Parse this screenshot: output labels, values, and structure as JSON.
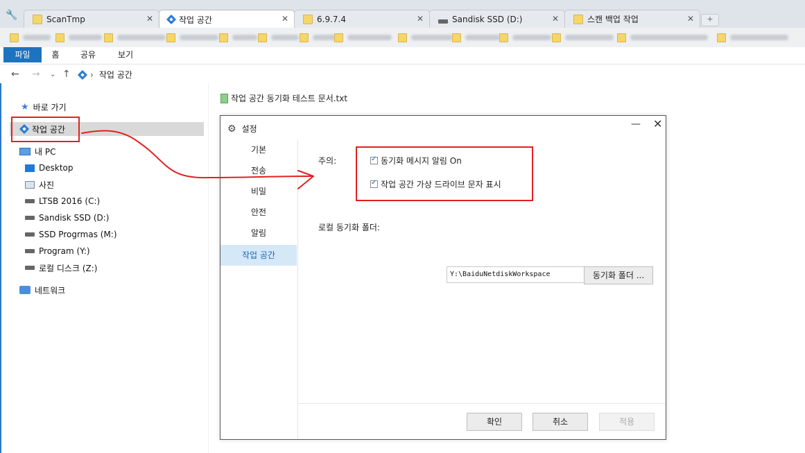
{
  "browser_tabs": [
    {
      "label": "ScanTmp",
      "icon": "folder-icon"
    },
    {
      "label": "작업 공간",
      "icon": "workspace-icon",
      "active": true
    },
    {
      "label": "6.9.7.4",
      "icon": "folder-icon"
    },
    {
      "label": "Sandisk SSD (D:)",
      "icon": "drive-icon"
    },
    {
      "label": "스캔 백업 작업",
      "icon": "folder-icon"
    }
  ],
  "ribbon": {
    "file": "파일",
    "home": "홈",
    "share": "공유",
    "view": "보기"
  },
  "address": {
    "crumb": "작업 공간"
  },
  "nav_pane": {
    "quick_access": "바로 가기",
    "workspace": "작업 공간",
    "this_pc": "내 PC",
    "desktop": "Desktop",
    "pictures": "사진",
    "drive_c": "LTSB 2016 (C:)",
    "drive_d": "Sandisk SSD (D:)",
    "drive_m": "SSD Progrmas (M:)",
    "drive_y": "Program (Y:)",
    "drive_z": "로컬 디스크 (Z:)",
    "network": "네트워크"
  },
  "file_list": {
    "file1": "작업 공간 동기화 테스트 문서.txt"
  },
  "dialog": {
    "title": "설정",
    "sidebar": [
      "기본",
      "전송",
      "비밀",
      "안전",
      "알림",
      "작업 공간"
    ],
    "notice_label": "주의:",
    "opt_sync_msg": "동기화 메시지 알림 On",
    "opt_virtual_drive": "작업 공간 가상 드라이브 문자 표시",
    "local_sync_folder_label": "로컬 동기화 폴더:",
    "local_sync_folder_value": "Y:\\BaiduNetdiskWorkspace",
    "sync_folder_button": "동기화 폴더 ...",
    "ok": "확인",
    "cancel": "취소",
    "apply": "적용"
  },
  "colors": {
    "accent": "#1e73be",
    "annotation": "#e32020",
    "selected_item": "#d5e8f8"
  }
}
